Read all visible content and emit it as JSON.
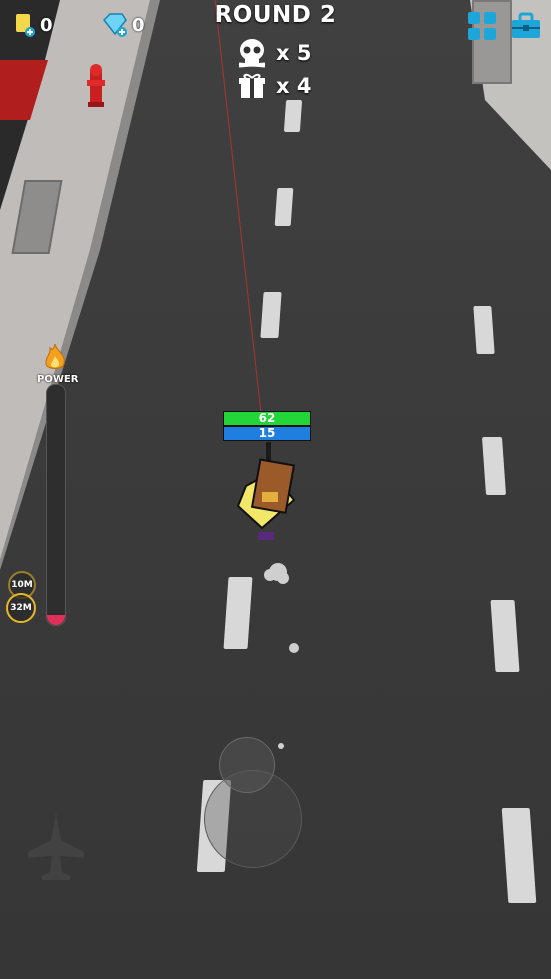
{
  "hud": {
    "round_title": "ROUND 2",
    "enemies_remaining": "x 5",
    "gifts_remaining": "x 4",
    "cards_count": "0",
    "gems_count": "0",
    "menu_icon": "grid-icon",
    "shop_icon": "toolbox-icon"
  },
  "power_meter": {
    "label": "POWER",
    "level": 0.04,
    "markers": [
      "10M",
      "32M"
    ]
  },
  "player": {
    "health": "62",
    "shield": "15"
  },
  "colors": {
    "health": "#22d63a",
    "shield": "#1f7fe0",
    "accent_cyan": "#1fa6d8",
    "power_fill": "#e0305a"
  }
}
